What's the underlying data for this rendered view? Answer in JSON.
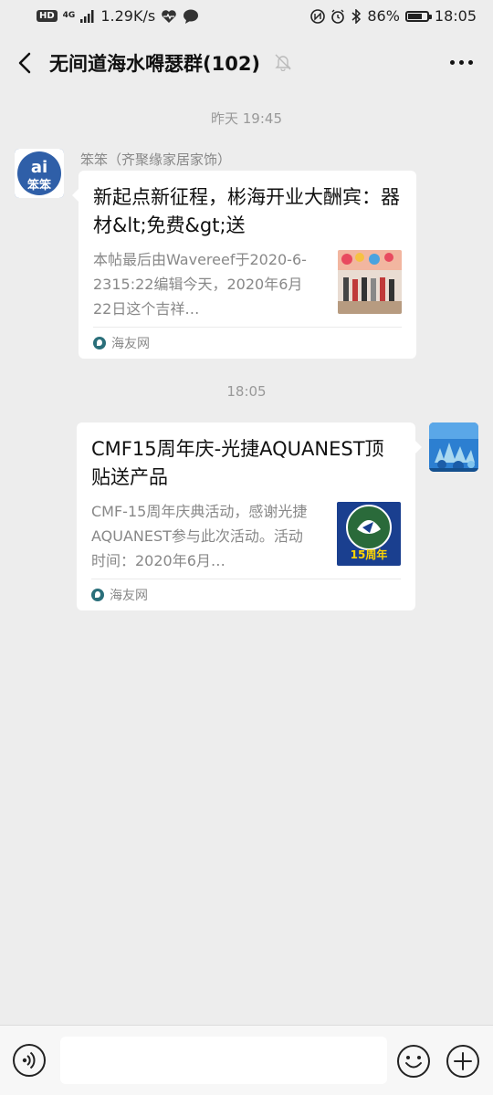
{
  "status_bar": {
    "hd": "HD",
    "network": "4G",
    "speed": "1.29K/s",
    "battery": "86%",
    "battery_level": 0.86,
    "time": "18:05"
  },
  "header": {
    "title": "无间道海水嘚瑟群(102)"
  },
  "chat": {
    "sep1": "昨天 19:45",
    "sep2": "18:05",
    "messages": [
      {
        "sender": "笨笨（齐聚缘家居家饰）",
        "avatar_text": "笨笨",
        "title": "新起点新征程，彬海开业大酬宾：器材&lt;免费&gt;送",
        "desc": "本帖最后由Wavereef于2020-6-2315:22编辑今天，2020年6月22日这个吉祥…",
        "source": "海友网"
      },
      {
        "title": "CMF15周年庆-光捷AQUANEST顶贴送产品",
        "desc": "CMF-15周年庆典活动，感谢光捷AQUANEST参与此次活动。活动时间：2020年6月…",
        "thumb_text": "15周年",
        "source": "海友网"
      }
    ]
  },
  "colors": {
    "background": "#ededed",
    "card": "#ffffff",
    "muted_text": "#888888"
  }
}
